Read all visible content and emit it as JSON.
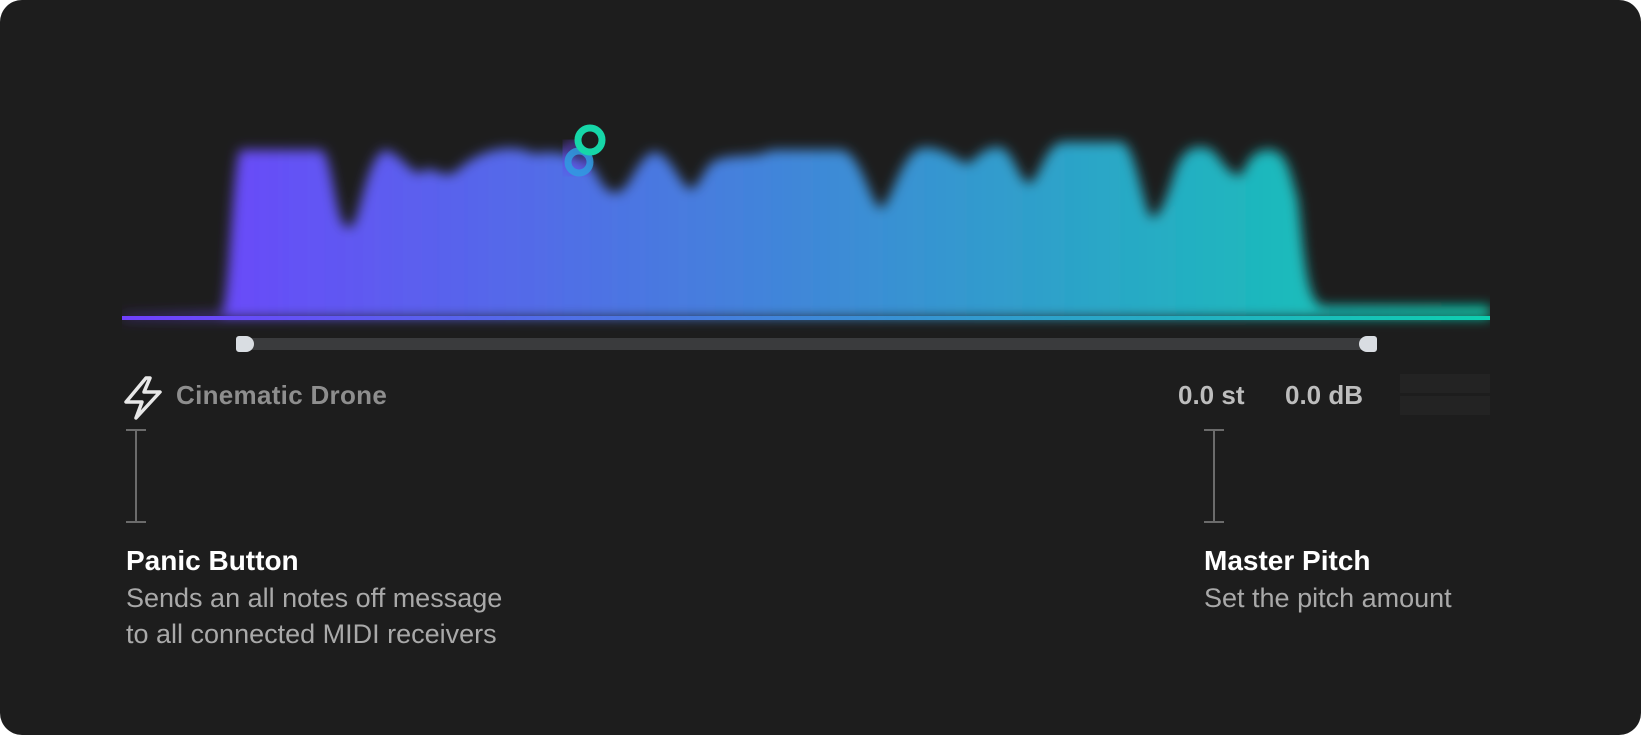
{
  "theme": {
    "background": "#1d1d1d",
    "gradient_start": "#7040ff",
    "gradient_mid": "#3f88d8",
    "gradient_end": "#0ecfb0",
    "cursor_teal": "#16d6a8",
    "cursor_purple": "#6a44e6"
  },
  "instrument": {
    "panic_icon": "lightning-bolt-icon",
    "preset_name": "Cinematic Drone",
    "pitch": "0.0 st",
    "gain": "0.0 dB"
  },
  "callouts": {
    "panic": {
      "title": "Panic Button",
      "line1": "Sends an all notes off message",
      "line2": "to all connected MIDI receivers"
    },
    "pitch": {
      "title": "Master Pitch",
      "line1": "Set the pitch amount"
    }
  }
}
